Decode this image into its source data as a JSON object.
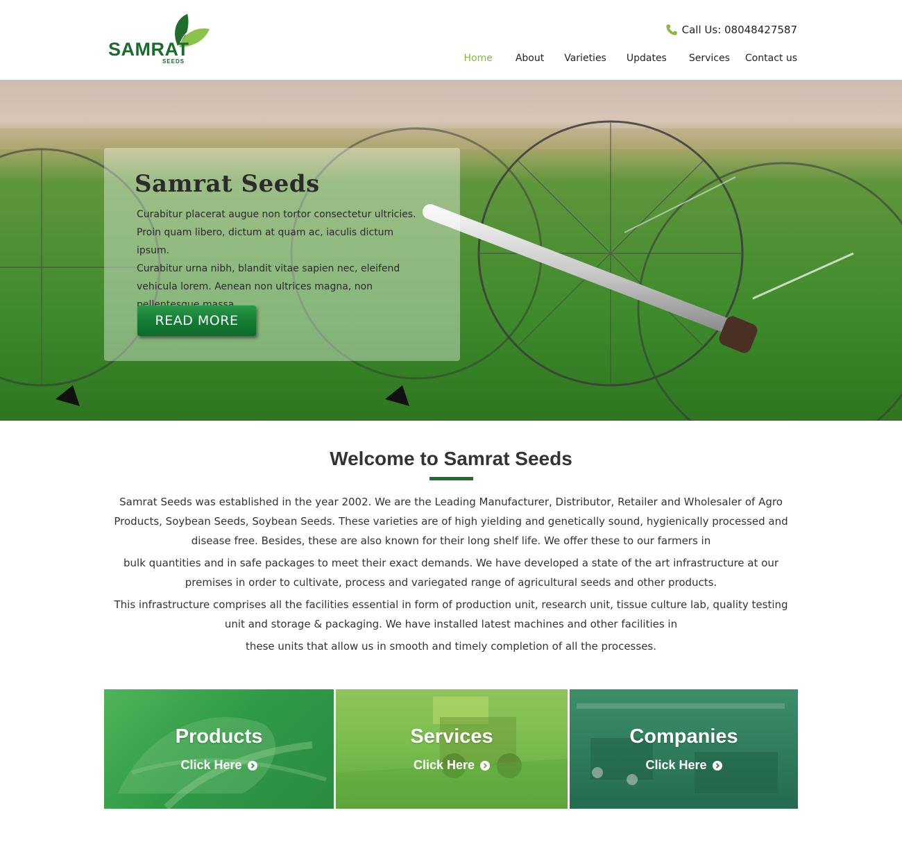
{
  "brand": {
    "name": "SAMRAT",
    "sub": "SEEDS",
    "colors": {
      "primary": "#1a6b2e",
      "accent": "#8bb83c"
    }
  },
  "header": {
    "phone_label": "Call Us: 08048427587",
    "nav": [
      {
        "label": "Home",
        "active": true
      },
      {
        "label": "About",
        "active": false
      },
      {
        "label": "Varieties",
        "active": false
      },
      {
        "label": "Updates",
        "active": false
      },
      {
        "label": "Services",
        "active": false
      },
      {
        "label": "Contact us",
        "active": false
      }
    ]
  },
  "hero": {
    "title": "Samrat Seeds",
    "lines": [
      "Curabitur placerat augue non tortor consectetur ultricies.",
      "Proin quam libero, dictum at quam ac, iaculis dictum ipsum.",
      "Curabitur urna nibh, blandit vitae sapien nec, eleifend",
      "vehicula lorem. Aenean non ultrices magna, non",
      "pellentesque massa."
    ],
    "button_label": "READ MORE"
  },
  "welcome": {
    "title": "Welcome to Samrat Seeds",
    "paragraphs": [
      "Samrat Seeds was established in the year 2002. We are the Leading Manufacturer, Distributor, Retailer and Wholesaler of Agro Products, Soybean Seeds, Soybean Seeds. These varieties are of high yielding and genetically sound, hygienically processed and disease free. Besides, these are also known for their long shelf life. We offer these to our farmers in",
      "bulk quantities and in safe packages to meet their exact demands. We have developed a state of the art infrastructure at our premises in order to cultivate, process and variegated range of agricultural seeds and other products.",
      "This infrastructure comprises all the facilities essential in form of production unit, research unit, tissue culture lab, quality testing unit and storage & packaging. We have installed latest machines and other facilities in",
      "these units that allow us in smooth and timely completion of all the processes."
    ]
  },
  "tiles": [
    {
      "label": "Products",
      "link": "Click Here",
      "icon": "chevron-right-circle-icon"
    },
    {
      "label": "Services",
      "link": "Click Here",
      "icon": "chevron-right-circle-icon"
    },
    {
      "label": "Companies",
      "link": "Click Here",
      "icon": "chevron-right-circle-icon"
    }
  ]
}
